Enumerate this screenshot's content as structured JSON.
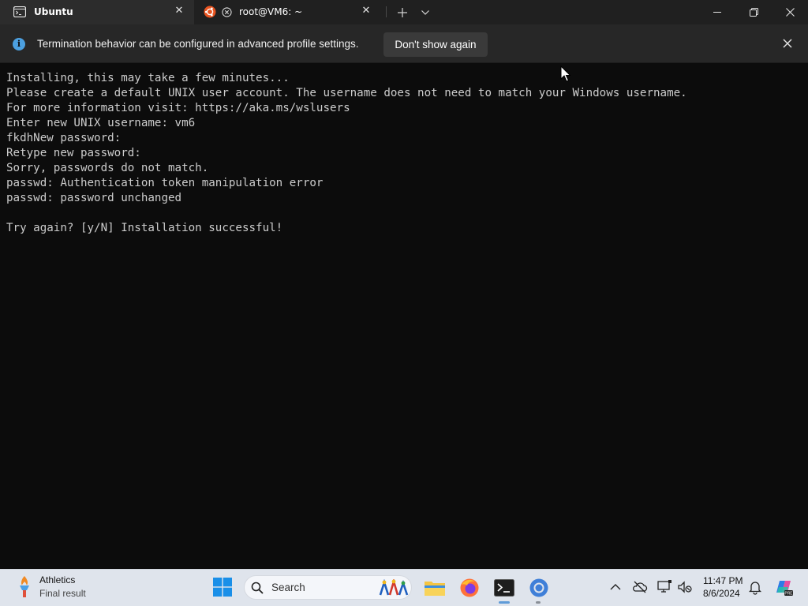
{
  "tabs": [
    {
      "label": "Ubuntu",
      "icon": "terminal-icon",
      "active": true
    },
    {
      "label": "root@VM6: ~",
      "icon": "ubuntu-icon",
      "active": false
    }
  ],
  "infobar": {
    "message": "Termination behavior can be configured in advanced profile settings.",
    "button_label": "Don't show again",
    "icon": "info-icon"
  },
  "terminal": {
    "lines": [
      "Installing, this may take a few minutes...",
      "Please create a default UNIX user account. The username does not need to match your Windows username.",
      "For more information visit: https://aka.ms/wslusers",
      "Enter new UNIX username: vm6",
      "fkdhNew password:",
      "Retype new password:",
      "Sorry, passwords do not match.",
      "passwd: Authentication token manipulation error",
      "passwd: password unchanged",
      "",
      "Try again? [y/N] Installation successful!"
    ]
  },
  "taskbar": {
    "widget_title": "Athletics",
    "widget_subtitle": "Final result",
    "search_placeholder": "Search",
    "apps": [
      "file-explorer-icon",
      "firefox-icon",
      "terminal-icon",
      "chrome-icon"
    ],
    "clock_time": "11:47 PM",
    "clock_date": "8/6/2024"
  },
  "colors": {
    "terminal_bg": "#0c0c0c",
    "terminal_fg": "#cccccc",
    "titlebar_bg": "#202020",
    "infobar_bg": "#272727",
    "accent": "#4ca0e0",
    "taskbar_bg": "#dfe4ec"
  }
}
